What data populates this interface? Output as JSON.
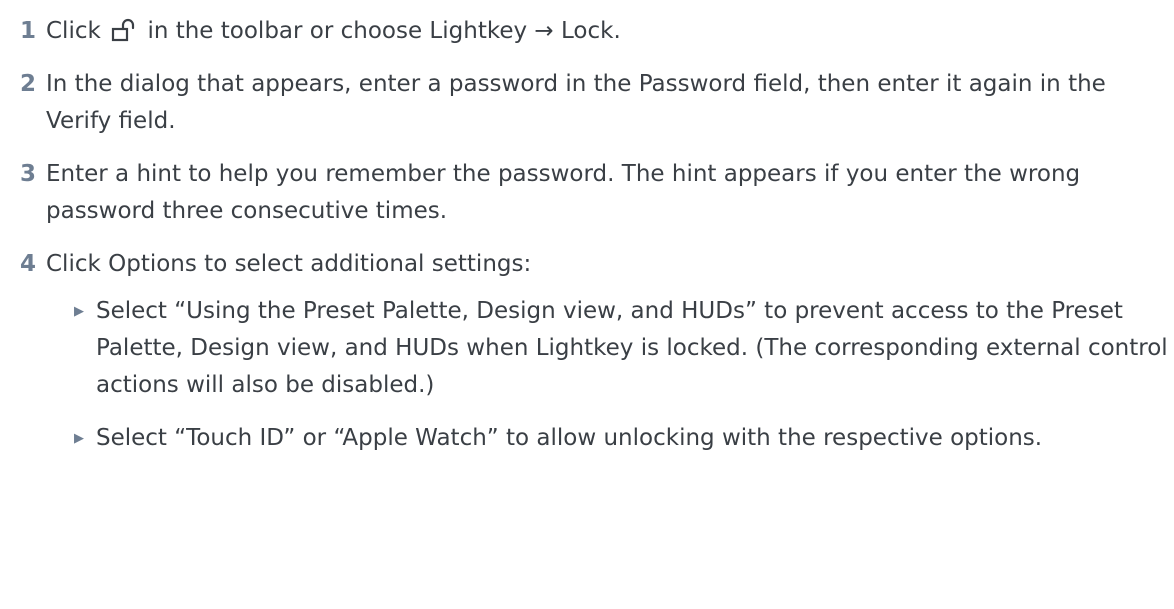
{
  "steps": [
    {
      "number": "1",
      "text_before_icon": "Click",
      "icon": "lock-open-icon",
      "text_after_icon": "in the toolbar or choose Lightkey",
      "arrow": "→",
      "text_after_arrow": "Lock."
    },
    {
      "number": "2",
      "text": "In the dialog that appears, enter a password in the Password field, then enter it again in the Verify field."
    },
    {
      "number": "3",
      "text": "Enter a hint to help you remember the password. The hint appears if you enter the wrong password three consecutive times."
    },
    {
      "number": "4",
      "text": "Click Options to select additional settings:",
      "bullets": [
        "Select “Using the Preset Palette, Design view, and HUDs” to prevent access to the Preset Palette, Design view, and HUDs when Lightkey is locked. (The corresponding external control actions will also be disabled.)",
        "Select “Touch ID” or “Apple Watch” to allow unlocking with the respective options."
      ]
    }
  ],
  "colors": {
    "step_number": "#6e7e92",
    "text": "#3a3f45",
    "bullet_mark": "#6e7e92"
  },
  "bullet_glyph": "▶"
}
